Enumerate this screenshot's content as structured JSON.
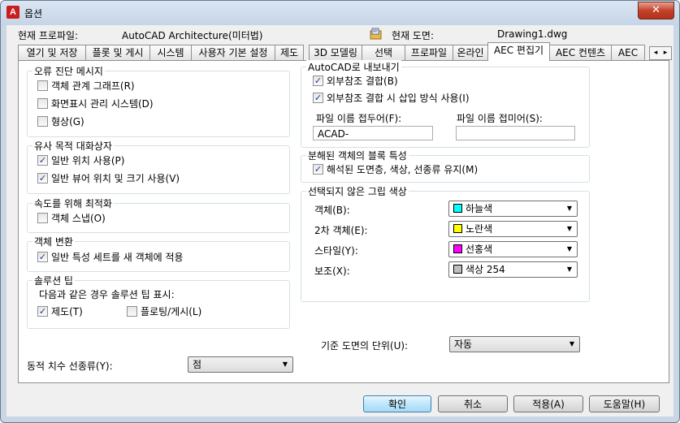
{
  "window": {
    "title": "옵션",
    "close_glyph": "✕"
  },
  "header": {
    "profile_label": "현재 프로파일:",
    "profile_value": "AutoCAD Architecture(미터법)",
    "drawing_label": "현재 도면:",
    "drawing_value": "Drawing1.dwg"
  },
  "tabs": [
    "열기 및 저장",
    "플롯 및 게시",
    "시스템",
    "사용자 기본 설정",
    "제도",
    "3D 모델링",
    "선택",
    "프로파일",
    "온라인",
    "AEC 편집기",
    "AEC 컨텐츠",
    "AEC"
  ],
  "active_tab": "AEC 편집기",
  "tab_scroll": {
    "left": "◂",
    "right": "▸"
  },
  "left": {
    "diagnostics": {
      "title": "오류 진단 메시지",
      "items": [
        {
          "label": "객체 관계 그래프(R)",
          "checked": false
        },
        {
          "label": "화면표시 관리 시스템(D)",
          "checked": false
        },
        {
          "label": "형상(G)",
          "checked": false
        }
      ]
    },
    "similar_dialogs": {
      "title": "유사 목적 대화상자",
      "items": [
        {
          "label": "일반 위치 사용(P)",
          "checked": true
        },
        {
          "label": "일반 뷰어 위치 및 크기 사용(V)",
          "checked": true
        }
      ]
    },
    "optimize": {
      "title": "속도를 위해 최적화",
      "items": [
        {
          "label": "객체 스냅(O)",
          "checked": false
        }
      ]
    },
    "object_conversion": {
      "title": "객체 변환",
      "items": [
        {
          "label": "일반 특성 세트를 새 객체에 적용",
          "checked": true
        }
      ]
    },
    "solution_tips": {
      "title": "솔루션 팁",
      "subtitle": "다음과 같은 경우 솔루션 팁 표시:",
      "items": [
        {
          "label": "제도(T)",
          "checked": true
        },
        {
          "label": "플로팅/게시(L)",
          "checked": false
        }
      ]
    },
    "dim_linetype": {
      "label": "동적 치수 선종류(Y):",
      "value": "점"
    }
  },
  "right": {
    "export": {
      "title": "AutoCAD로 내보내기",
      "items": [
        {
          "label": "외부참조 결합(B)",
          "checked": true
        },
        {
          "label": "외부참조 결합 시 삽입 방식 사용(I)",
          "checked": true
        }
      ],
      "prefix_label": "파일 이름 접두어(F):",
      "prefix_value": "ACAD-",
      "suffix_label": "파일 이름 접미어(S):",
      "suffix_value": ""
    },
    "exploded": {
      "title": "분해된 객체의 블록 특성",
      "items": [
        {
          "label": "해석된 도면층, 색상, 선종류 유지(M)",
          "checked": true
        }
      ]
    },
    "grip_colors": {
      "title": "선택되지 않은 그립 색상",
      "rows": [
        {
          "label": "객체(B):",
          "value": "하늘색",
          "color": "#00ffff"
        },
        {
          "label": "2차 객체(E):",
          "value": "노란색",
          "color": "#ffff00"
        },
        {
          "label": "스타일(Y):",
          "value": "선홍색",
          "color": "#ff00ff"
        },
        {
          "label": "보조(X):",
          "value": "색상 254",
          "color": "#bebebe"
        }
      ]
    },
    "base_units": {
      "label": "기준 도면의 단위(U):",
      "value": "자동"
    }
  },
  "buttons": {
    "ok": "확인",
    "cancel": "취소",
    "apply": "적용(A)",
    "help": "도움말(H)"
  },
  "glyphs": {
    "check": "✓",
    "dropdown": "▼"
  }
}
